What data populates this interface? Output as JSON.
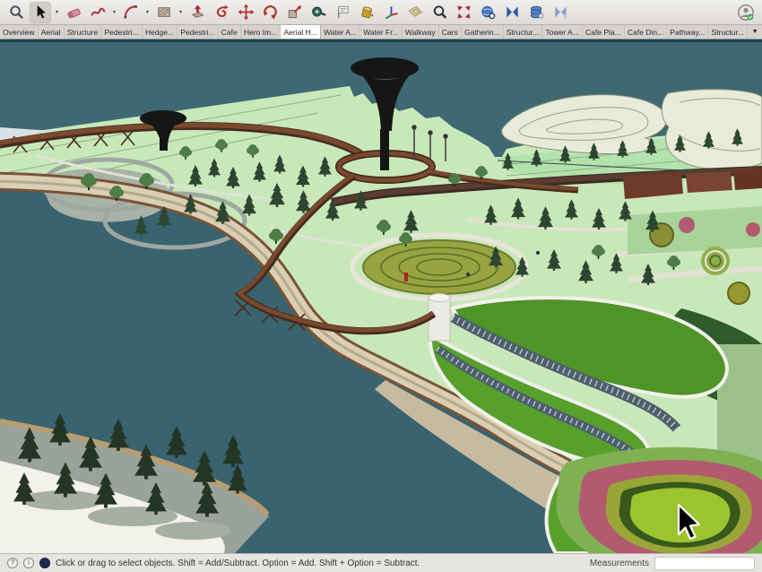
{
  "toolbar": {
    "icons": [
      {
        "name": "search-tool"
      },
      {
        "name": "select-tool",
        "active": true
      },
      {
        "name": "eraser-tool"
      },
      {
        "name": "freehand-tool"
      },
      {
        "name": "arc-tool"
      },
      {
        "name": "rectangle-tool"
      },
      {
        "name": "push-pull-tool"
      },
      {
        "name": "follow-me-tool"
      },
      {
        "name": "move-tool"
      },
      {
        "name": "rotate-tool"
      },
      {
        "name": "scale-tool"
      },
      {
        "name": "tape-measure-tool"
      },
      {
        "name": "dimension-text-tool"
      },
      {
        "name": "paint-bucket-tool"
      },
      {
        "name": "component-axes-tool"
      },
      {
        "name": "section-plane-tool"
      },
      {
        "name": "zoom-tool"
      },
      {
        "name": "zoom-extents-tool"
      },
      {
        "name": "add-location-tool"
      },
      {
        "name": "previous-view-tool"
      },
      {
        "name": "layers-stack-tool"
      },
      {
        "name": "next-view-tool"
      },
      {
        "name": "user-account-icon"
      }
    ]
  },
  "tabs": {
    "items": [
      {
        "label": "Overview"
      },
      {
        "label": "Aerial"
      },
      {
        "label": "Structure"
      },
      {
        "label": "Pedestri..."
      },
      {
        "label": "Hedge..."
      },
      {
        "label": "Pedestri..."
      },
      {
        "label": "Cafe"
      },
      {
        "label": "Hero Im..."
      },
      {
        "label": "Aerial H...",
        "active": true
      },
      {
        "label": "Water A..."
      },
      {
        "label": "Water Fr..."
      },
      {
        "label": "Walkway"
      },
      {
        "label": "Cars"
      },
      {
        "label": "Gatherin..."
      },
      {
        "label": "Structur..."
      },
      {
        "label": "Tower A..."
      },
      {
        "label": "Cafe Pla..."
      },
      {
        "label": "Cafe Din..."
      },
      {
        "label": "Pathway..."
      },
      {
        "label": "Structur..."
      }
    ],
    "overflow_glyph": "▼"
  },
  "statusbar": {
    "help_glyph": "?",
    "info_glyph": "i",
    "message": "Click or drag to select objects. Shift = Add/Subtract. Option = Add. Shift + Option = Subtract.",
    "measurements_label": "Measurements",
    "measurements_value": ""
  },
  "palette": {
    "water": "#3e6973",
    "lake": "#3a6370",
    "island_cream": "#e9ebd9",
    "island_line": "#9aa289",
    "mint": "#b2e3ac",
    "park_green": "#c9e8ba",
    "road_cream": "#d9cfb4",
    "road_brown": "#7a5436",
    "sand": "#c7ba9f",
    "boardwalk": "#7a4a2e",
    "boardwalk_dark": "#462d1e",
    "tree_dark": "#2c4631",
    "tree_round": "#4f7d46",
    "pine_dark": "#243524",
    "path_gray": "#9fa8a0",
    "shore_white": "#f2f1ea",
    "shore_gray": "#9aa39b",
    "maze_olive": "#97a441",
    "glass": "#4e5f6b",
    "roof_green": "#4f9427",
    "roof_green2": "#57a02c",
    "mound_outer": "#7fb052",
    "mound_pink": "#b25a70",
    "mound_olive": "#99a637",
    "mound_dark_ring": "#37591c",
    "mound_center": "#9cc42e",
    "brick": "#6e3a29",
    "tower_black": "#161616"
  }
}
